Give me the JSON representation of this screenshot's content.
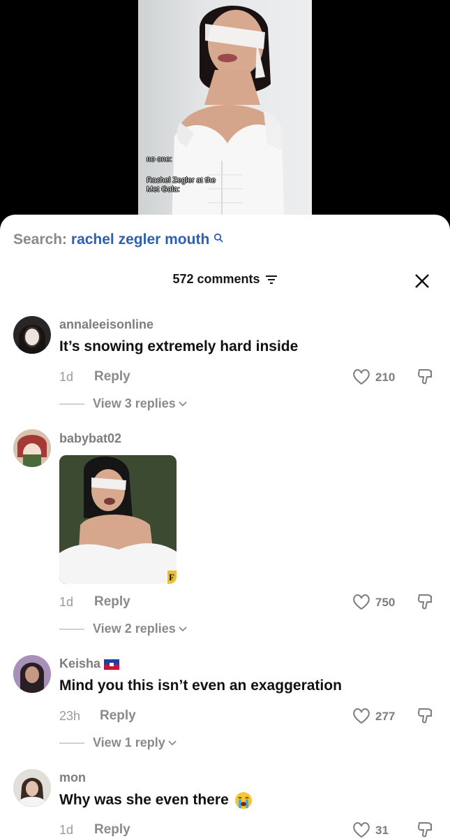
{
  "video": {
    "caption_line1": "no one:",
    "caption_line2": "Rachel Zegler at the",
    "caption_line3": "Met Gala:"
  },
  "search": {
    "label": "Search:",
    "query": "rachel zegler mouth"
  },
  "header": {
    "comments_count": "572 comments"
  },
  "comments": [
    {
      "username": "annaleeisonline",
      "text": "It’s snowing extremely hard inside",
      "time": "1d",
      "reply": "Reply",
      "likes": "210",
      "view_replies": "View 3 replies"
    },
    {
      "username": "babybat02",
      "time": "1d",
      "reply": "Reply",
      "likes": "750",
      "view_replies": "View 2 replies",
      "gif_letter": "F"
    },
    {
      "username": "Keisha",
      "text": "Mind you this isn’t even an exaggeration",
      "time": "23h",
      "reply": "Reply",
      "likes": "277",
      "view_replies": "View 1 reply"
    },
    {
      "username": "mon",
      "text": "Why was she even there",
      "time": "1d",
      "reply": "Reply",
      "likes": "31"
    }
  ],
  "colors": {
    "search_query": "#2f5fb0",
    "sheet": "#ffffff",
    "muted": "#8a8a8a"
  }
}
